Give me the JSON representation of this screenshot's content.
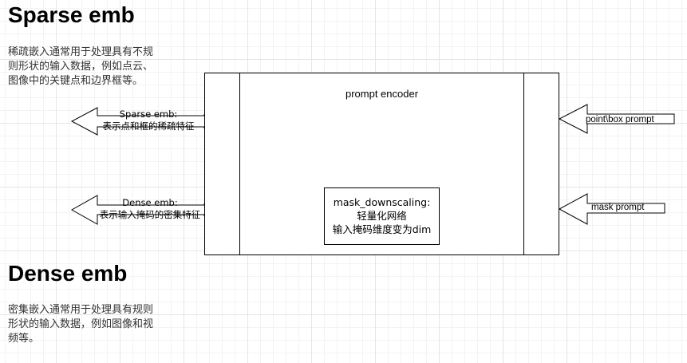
{
  "sparse": {
    "heading": "Sparse emb",
    "description_lines": [
      "稀疏嵌入通常用于处理具有不规",
      "则形状的输入数据，例如点云、",
      "图像中的关键点和边界框等。"
    ]
  },
  "dense": {
    "heading": "Dense emb",
    "description_lines": [
      "密集嵌入通常用于处理具有规则",
      "形状的输入数据，例如图像和视",
      "频等。"
    ]
  },
  "encoder": {
    "title": "prompt encoder",
    "mask_block_lines": [
      "mask_downscaling:",
      "轻量化网络",
      "输入掩码维度变为dim"
    ]
  },
  "outputs": {
    "sparse_lines": [
      "Sparse emb:",
      "表示点和框的稀疏特征"
    ],
    "dense_lines": [
      "Dense emb:",
      "表示输入掩码的密集特征"
    ]
  },
  "inputs": {
    "point_box": "point\\box prompt",
    "mask": "mask prompt"
  },
  "colors": {
    "stroke": "#000000",
    "grid_major": "#e6e6e6",
    "grid_minor": "#f3f3f3"
  }
}
